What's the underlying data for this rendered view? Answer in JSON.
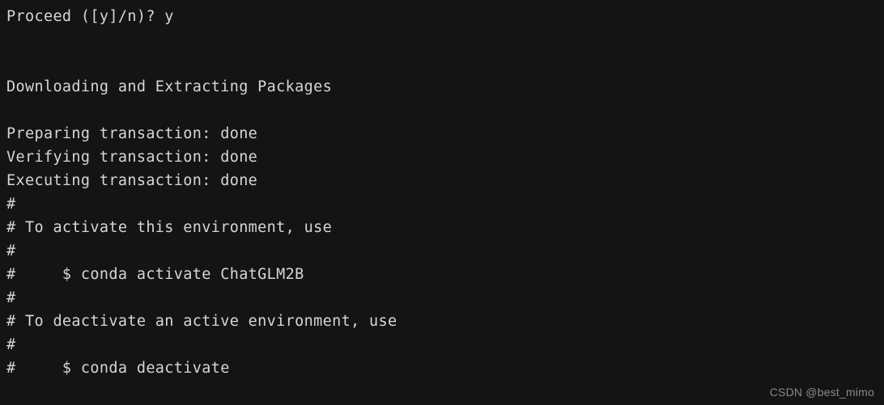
{
  "terminal": {
    "background_color": "#141414",
    "text_color": "#d6d6d6",
    "lines": [
      "Proceed ([y]/n)? y",
      "",
      "",
      "Downloading and Extracting Packages",
      "",
      "Preparing transaction: done",
      "Verifying transaction: done",
      "Executing transaction: done",
      "#",
      "# To activate this environment, use",
      "#",
      "#     $ conda activate ChatGLM2B",
      "#",
      "# To deactivate an active environment, use",
      "#",
      "#     $ conda deactivate"
    ]
  },
  "watermark": {
    "text": "CSDN @best_mimo",
    "color": "#8a8a8a"
  }
}
